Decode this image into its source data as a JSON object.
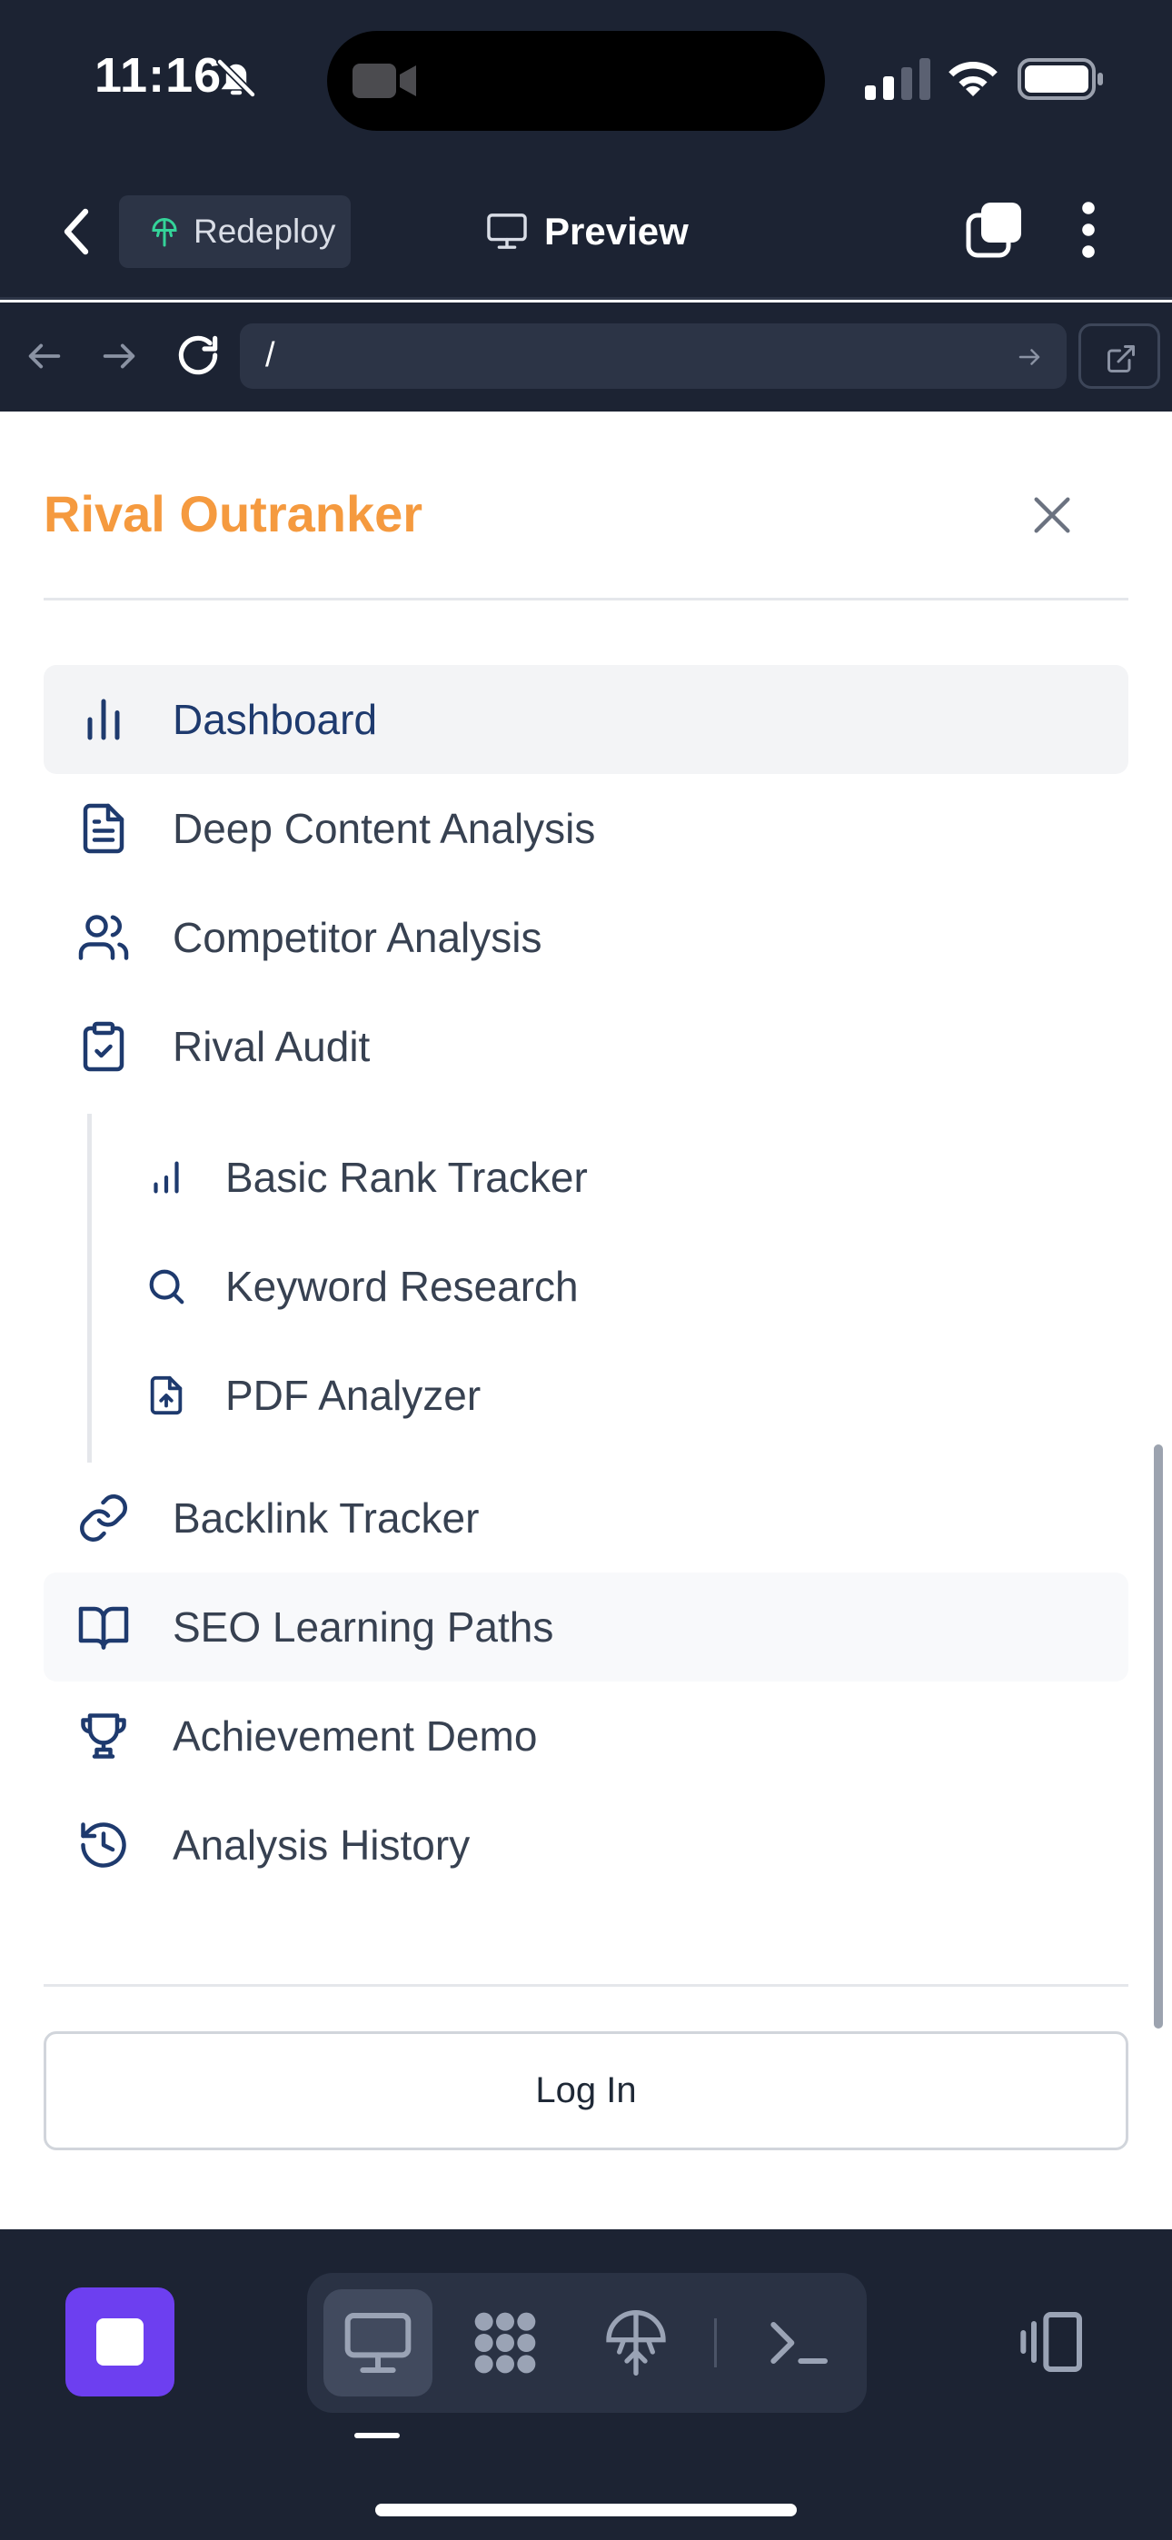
{
  "status_bar": {
    "time": "11:16",
    "icons": [
      "bell-slash-icon",
      "video-camera-icon",
      "cellular-signal-icon",
      "wifi-icon",
      "battery-icon"
    ]
  },
  "app_header": {
    "redeploy_label": "Redeploy",
    "preview_label": "Preview",
    "icons": [
      "back-chevron-icon",
      "redeploy-icon",
      "monitor-icon",
      "tabs-icon",
      "more-vertical-icon"
    ]
  },
  "url_bar": {
    "value": "/",
    "icons": [
      "arrow-left-icon",
      "arrow-right-icon",
      "reload-icon",
      "go-arrow-icon",
      "external-link-icon"
    ]
  },
  "menu": {
    "brand": "Rival Outranker",
    "brand_color": "#f59a3f",
    "active_item": "Dashboard",
    "items": [
      {
        "label": "Dashboard",
        "icon": "bar-chart-icon"
      },
      {
        "label": "Deep Content Analysis",
        "icon": "document-icon"
      },
      {
        "label": "Competitor Analysis",
        "icon": "users-icon"
      },
      {
        "label": "Rival Audit",
        "icon": "clipboard-check-icon"
      },
      {
        "label": "Backlink Tracker",
        "icon": "link-icon"
      },
      {
        "label": "SEO Learning Paths",
        "icon": "book-open-icon"
      },
      {
        "label": "Achievement Demo",
        "icon": "trophy-icon"
      },
      {
        "label": "Analysis History",
        "icon": "history-icon"
      }
    ],
    "sub_items": [
      {
        "label": "Basic Rank Tracker",
        "icon": "bar-chart-small-icon"
      },
      {
        "label": "Keyword Research",
        "icon": "search-icon"
      },
      {
        "label": "PDF Analyzer",
        "icon": "file-upload-icon"
      }
    ],
    "login_label": "Log In"
  },
  "bottom_toolbar": {
    "accent_color": "#6d3ff0",
    "icons": [
      "stop-icon",
      "desktop-icon",
      "apps-icon",
      "deploy-icon",
      "terminal-icon",
      "device-toggle-icon"
    ]
  }
}
